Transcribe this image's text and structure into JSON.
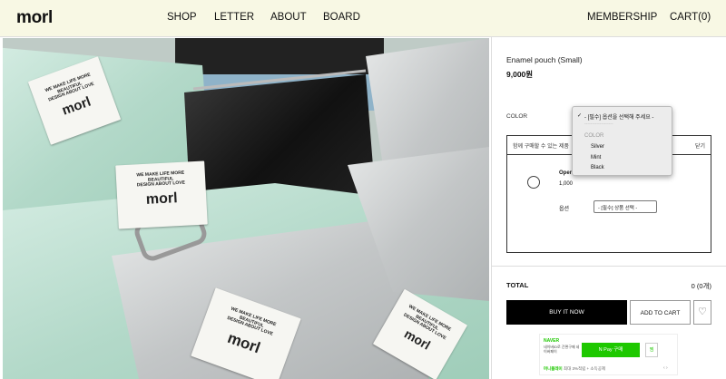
{
  "header": {
    "logo": "morl",
    "nav": [
      "SHOP",
      "LETTER",
      "ABOUT",
      "BOARD"
    ],
    "right": [
      "MEMBERSHIP",
      "CART(0)"
    ]
  },
  "product": {
    "name": "Enamel pouch (Small)",
    "price": "9,000원"
  },
  "option": {
    "color_label": "COLOR",
    "header_text": "함께 구매할 수 있는 제품",
    "close_label": "닫기",
    "related_name": "Open",
    "related_price": "1,000",
    "option_label": "옵션",
    "select_value": "- [필수] 상품 선택 -"
  },
  "dropdown": {
    "selected": "- [필수] 옵션을 선택해 주세요 -",
    "divider": "-------------------",
    "group": "COLOR",
    "options": [
      "Silver",
      "Mint",
      "Black"
    ]
  },
  "total": {
    "label": "TOTAL",
    "value": "0 (0개)"
  },
  "actions": {
    "buy": "BUY IT NOW",
    "cart": "ADD TO CART"
  },
  "naver": {
    "logo": "NAVER",
    "desc": "네이버ID로 간편구매 네이버페이",
    "pay": "N Pay 구매",
    "zzim": "찜",
    "footer_brand": "머니플레이",
    "footer_text": "최대 3%적립 + 소득공제"
  },
  "hero_labels": {
    "line1": "WE MAKE LIFE MORE",
    "line2": "BEAUTIFUL",
    "line3": "DESIGN ABOUT LOVE",
    "brand": "morl"
  },
  "colors": {
    "header_bg": "#f8f8e4",
    "mint": "#b9dccd",
    "black_pouch": "#1b1b1b",
    "silver": "#c7cacb",
    "naver_green": "#1ec800"
  }
}
